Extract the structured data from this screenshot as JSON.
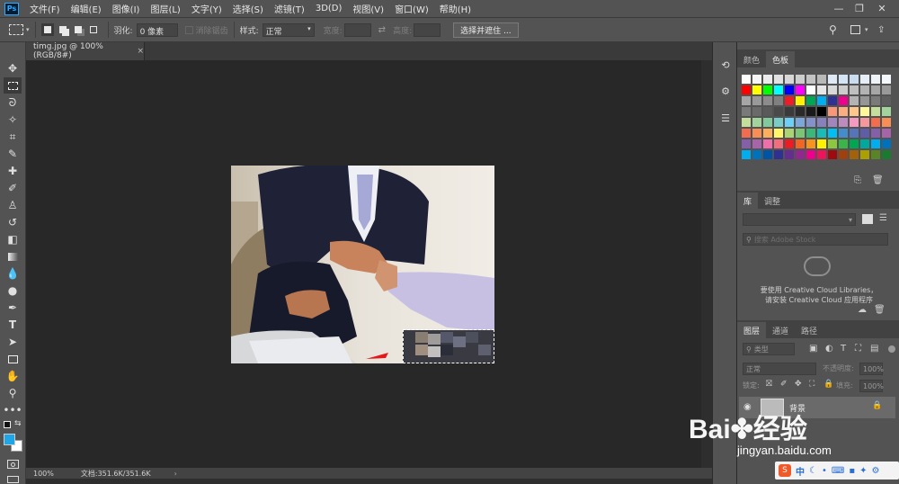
{
  "app": {
    "logo_text": "Ps",
    "menu": [
      "文件(F)",
      "编辑(E)",
      "图像(I)",
      "图层(L)",
      "文字(Y)",
      "选择(S)",
      "滤镜(T)",
      "3D(D)",
      "视图(V)",
      "窗口(W)",
      "帮助(H)"
    ],
    "window_controls": {
      "minimize": "—",
      "restore": "❐",
      "close": "✕"
    }
  },
  "options": {
    "feather_label": "羽化:",
    "feather_value": "0 像素",
    "antialias_label": "消除锯齿",
    "style_label": "样式:",
    "style_value": "正常",
    "width_label": "宽度:",
    "height_label": "高度:",
    "select_mask_button": "选择并遮住 ..."
  },
  "document": {
    "tab_title": "timg.jpg @ 100%(RGB/8#)",
    "tab_close": "×",
    "zoom": "100%",
    "doc_info": "文档:351.6K/351.6K",
    "status_arrow": "›"
  },
  "panels": {
    "color_tabs": [
      "颜色",
      "色板"
    ],
    "library_tabs": [
      "库",
      "调整"
    ],
    "library_search_placeholder": "搜索 Adobe Stock",
    "cc_message_line1": "要使用 Creative Cloud Libraries，",
    "cc_message_line2": "请安装 Creative Cloud 应用程序",
    "layers_tabs": [
      "图层",
      "通道",
      "路径"
    ],
    "layer_filter": "类型",
    "blend_mode": "正常",
    "opacity_label": "不透明度:",
    "opacity_value": "100%",
    "lock_label": "锁定:",
    "fill_label": "填充:",
    "fill_value": "100%",
    "layer_name": "背景"
  },
  "colors": {
    "accent": "#31a8ff",
    "foreground": "#1ea6e6",
    "background": "#ffffff"
  },
  "swatches": [
    [
      "#ffffff",
      "#f5f5f5",
      "#ebebeb",
      "#e1e1e1",
      "#d7d7d7",
      "#cdcdcd",
      "#c3c3c3",
      "#b9b9b9",
      "#dde9f5",
      "#d3e4f5",
      "#c9dcf0",
      "#e5eef7",
      "#eef3f9",
      "#f4f8fc"
    ],
    [
      "#ff0000",
      "#ffff00",
      "#00ff00",
      "#00ffff",
      "#0000ff",
      "#ff00ff",
      "#ffffff",
      "#e6e6e6",
      "#d9d9d9",
      "#cccccc",
      "#bfbfbf",
      "#b3b3b3",
      "#a6a6a6",
      "#999999"
    ],
    [
      "#a6a6a6",
      "#999999",
      "#8c8c8c",
      "#808080",
      "#ee1c24",
      "#fff200",
      "#00a651",
      "#00aeef",
      "#2e3192",
      "#ec008c",
      "#b3b3b3",
      "#969696",
      "#7a7a7a",
      "#5e5e5e"
    ],
    [
      "#7a7a7a",
      "#6a6a6a",
      "#5a5a5a",
      "#4a4a4a",
      "#3a3a3a",
      "#2a2a2a",
      "#1a1a1a",
      "#000000",
      "#f7977a",
      "#f9ad81",
      "#fdc68a",
      "#fff79a",
      "#c4df9b",
      "#a3d39c"
    ],
    [
      "#c4df9b",
      "#a3d39c",
      "#82ca9c",
      "#7accc8",
      "#6dcff6",
      "#7da7d9",
      "#8393ca",
      "#8781bd",
      "#a186be",
      "#bd8cbf",
      "#f49ac1",
      "#f5989d",
      "#f26c4f",
      "#f68e56"
    ],
    [
      "#f26c4f",
      "#f68e56",
      "#fbaf5d",
      "#fff568",
      "#acd373",
      "#7cc576",
      "#3bb878",
      "#1abbb4",
      "#00bff3",
      "#448ccb",
      "#5574b9",
      "#605ca8",
      "#855fa8",
      "#a864a8"
    ],
    [
      "#855fa8",
      "#a864a8",
      "#f06eaa",
      "#f26d7d",
      "#ed1c24",
      "#f26522",
      "#f7941d",
      "#fff200",
      "#8dc63f",
      "#39b54a",
      "#00a651",
      "#00a99d",
      "#00aeef",
      "#0072bc"
    ],
    [
      "#00aeef",
      "#0072bc",
      "#0054a6",
      "#2e3192",
      "#662d91",
      "#92278f",
      "#ec008c",
      "#ed145b",
      "#9e0b0f",
      "#a0410d",
      "#a36209",
      "#aba000",
      "#598527",
      "#1a7b30"
    ]
  ],
  "watermark": {
    "brand": "Bai",
    "brand_suffix": "经验",
    "url": "jingyan.baidu.com"
  },
  "tray": {
    "ime": "中",
    "items": [
      "☾",
      "•",
      "⌨",
      "▪",
      "✦",
      "⚙"
    ]
  }
}
